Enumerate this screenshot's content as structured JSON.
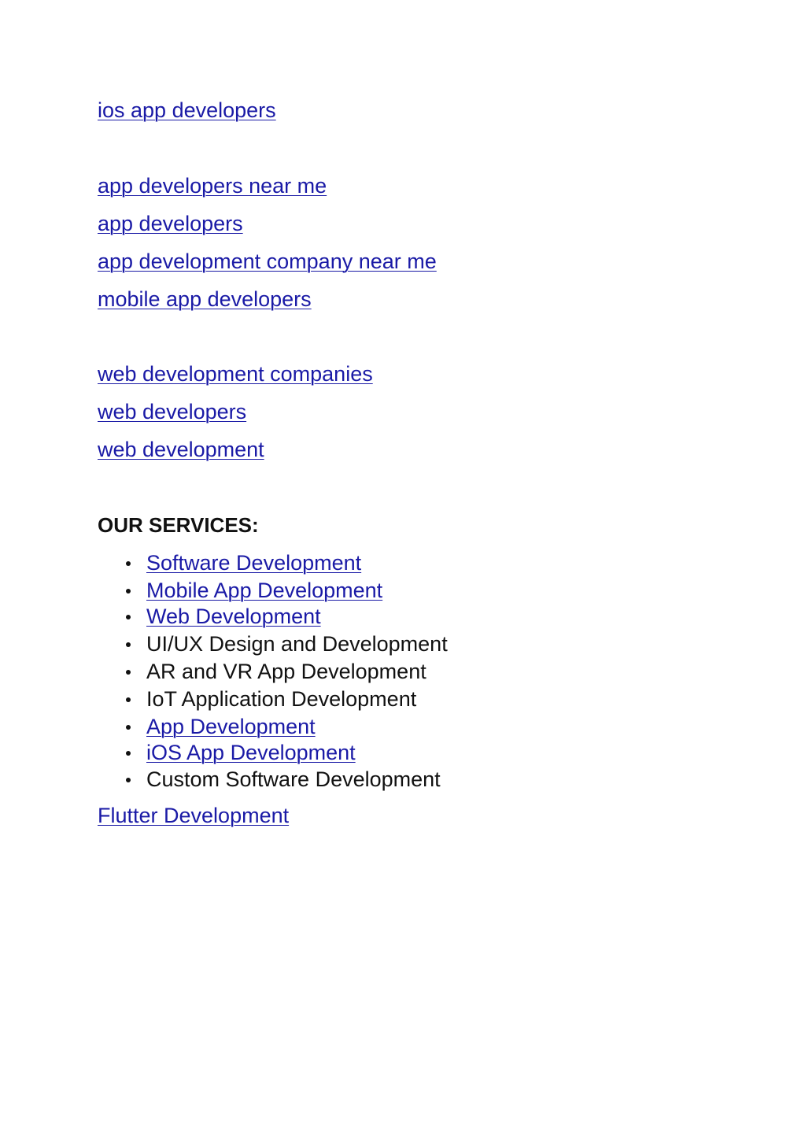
{
  "links_group_1": [
    "ios app developers"
  ],
  "links_group_2": [
    "app developers near me",
    "app developers",
    "app development company near me",
    "mobile app developers"
  ],
  "links_group_3": [
    "web development companies",
    "web developers",
    "web development"
  ],
  "services": {
    "heading": "OUR SERVICES:",
    "items": [
      {
        "label": "Software Development",
        "is_link": true
      },
      {
        "label": "Mobile App Development",
        "is_link": true
      },
      {
        "label": "Web Development",
        "is_link": true
      },
      {
        "label": "UI/UX Design and Development",
        "is_link": false
      },
      {
        "label": "AR and VR App Development",
        "is_link": false
      },
      {
        "label": "IoT Application Development",
        "is_link": false
      },
      {
        "label": "App Development",
        "is_link": true
      },
      {
        "label": "iOS App Development",
        "is_link": true
      },
      {
        "label": "Custom Software Development",
        "is_link": false
      }
    ]
  },
  "footer_link": "Flutter Development",
  "colors": {
    "link": "#1a1aa6",
    "text": "#111111",
    "background": "#ffffff"
  }
}
